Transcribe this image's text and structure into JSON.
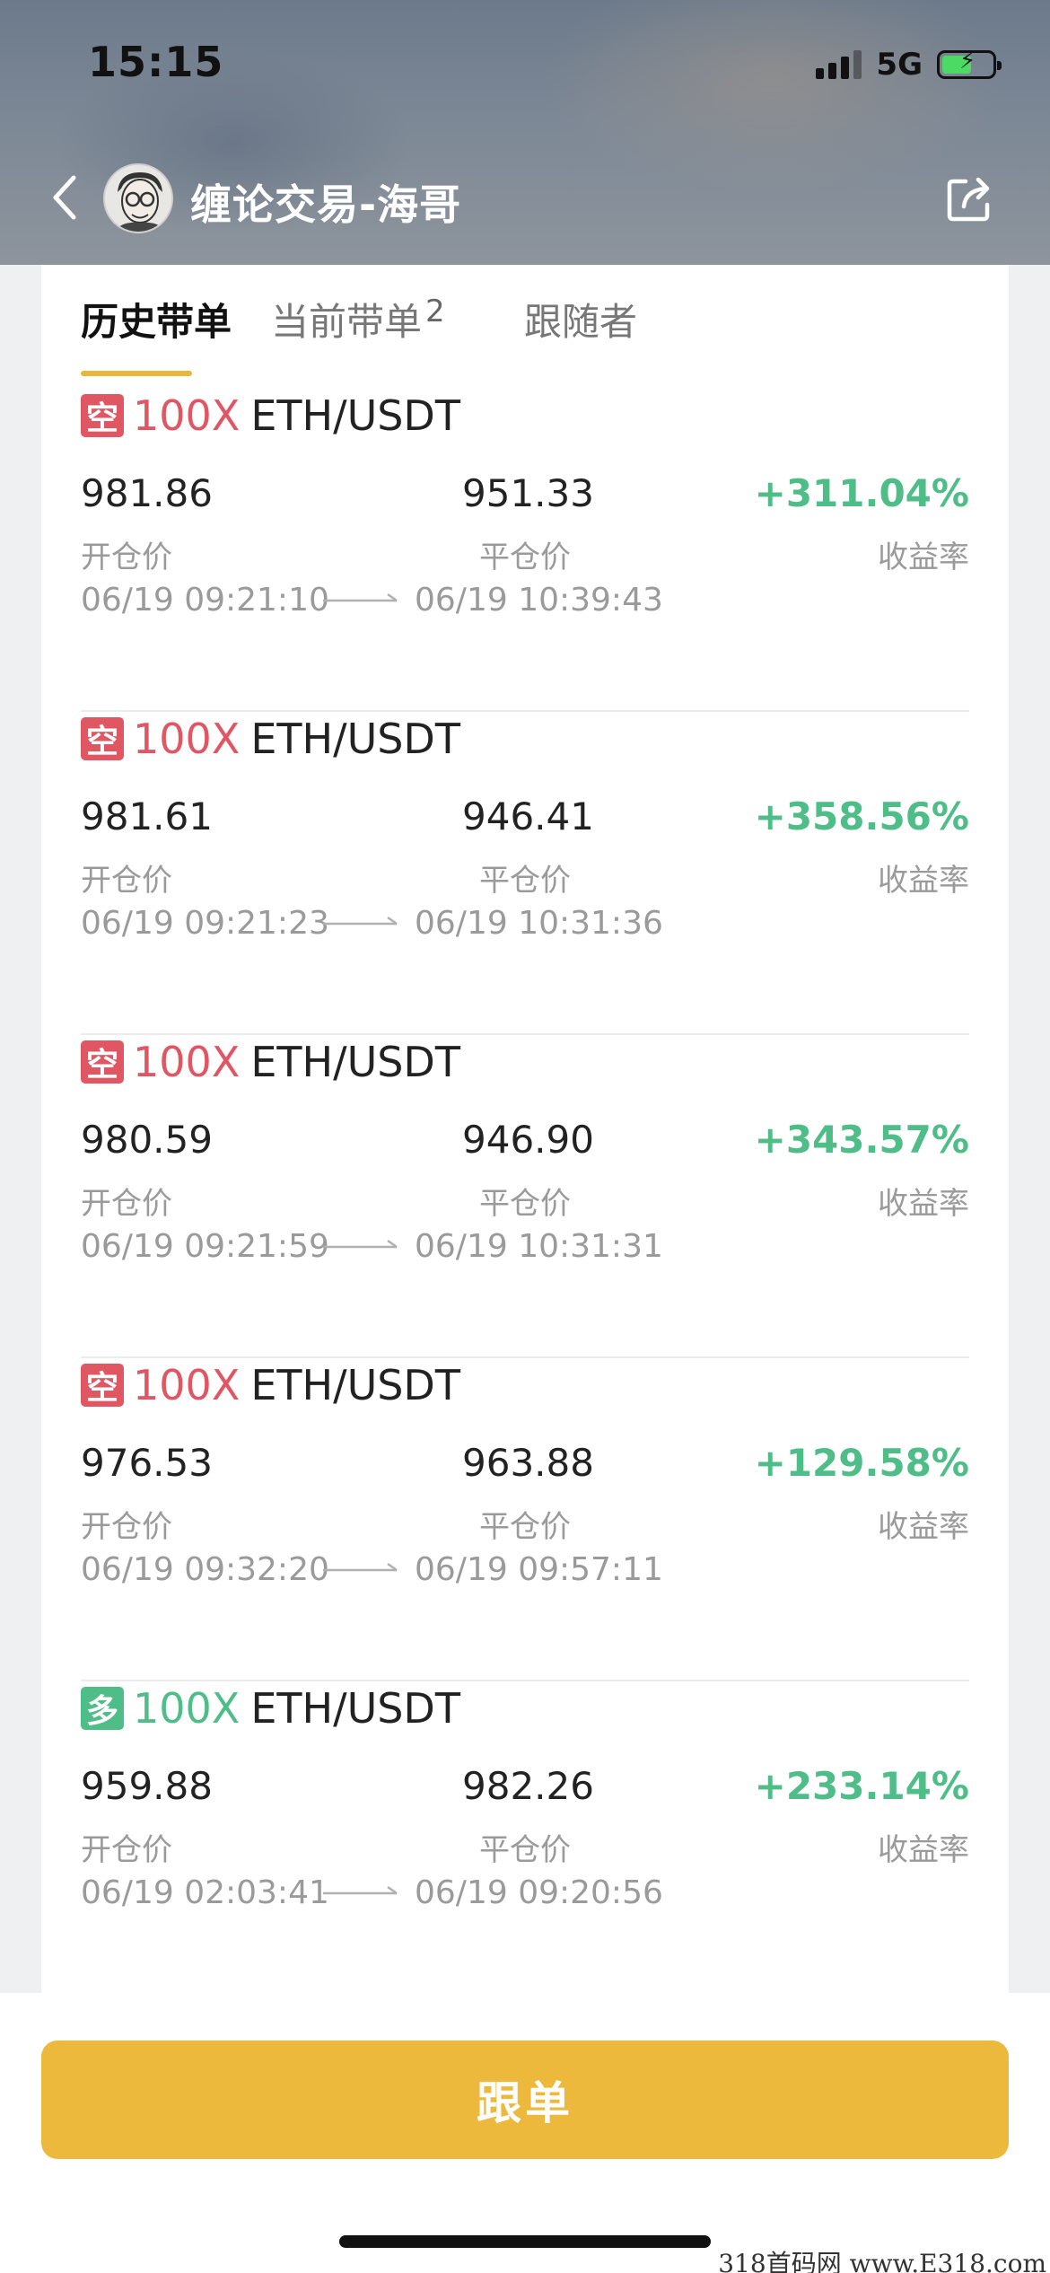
{
  "status_bar": {
    "time": "15:15",
    "network": "5G"
  },
  "nav": {
    "title": "缠论交易-海哥"
  },
  "tabs": [
    {
      "label": "历史带单",
      "active": true
    },
    {
      "label": "当前带单",
      "badge": "2",
      "active": false
    },
    {
      "label": "跟随者",
      "active": false
    }
  ],
  "labels": {
    "open_price": "开仓价",
    "close_price": "平仓价",
    "yield": "收益率"
  },
  "trades": [
    {
      "side": "空",
      "side_type": "short",
      "leverage": "100X",
      "pair": "ETH/USDT",
      "open": "981.86",
      "close": "951.33",
      "pct": "+311.04%",
      "open_time": "06/19 09:21:10",
      "close_time": "06/19 10:39:43"
    },
    {
      "side": "空",
      "side_type": "short",
      "leverage": "100X",
      "pair": "ETH/USDT",
      "open": "981.61",
      "close": "946.41",
      "pct": "+358.56%",
      "open_time": "06/19 09:21:23",
      "close_time": "06/19 10:31:36"
    },
    {
      "side": "空",
      "side_type": "short",
      "leverage": "100X",
      "pair": "ETH/USDT",
      "open": "980.59",
      "close": "946.90",
      "pct": "+343.57%",
      "open_time": "06/19 09:21:59",
      "close_time": "06/19 10:31:31"
    },
    {
      "side": "空",
      "side_type": "short",
      "leverage": "100X",
      "pair": "ETH/USDT",
      "open": "976.53",
      "close": "963.88",
      "pct": "+129.58%",
      "open_time": "06/19 09:32:20",
      "close_time": "06/19 09:57:11"
    },
    {
      "side": "多",
      "side_type": "long",
      "leverage": "100X",
      "pair": "ETH/USDT",
      "open": "959.88",
      "close": "982.26",
      "pct": "+233.14%",
      "open_time": "06/19 02:03:41",
      "close_time": "06/19 09:20:56"
    }
  ],
  "follow_button": "跟单",
  "watermark": "318首码网 www.E318.com",
  "colors": {
    "short": "#e05663",
    "long": "#4fbd87",
    "accent": "#ecb93c"
  }
}
